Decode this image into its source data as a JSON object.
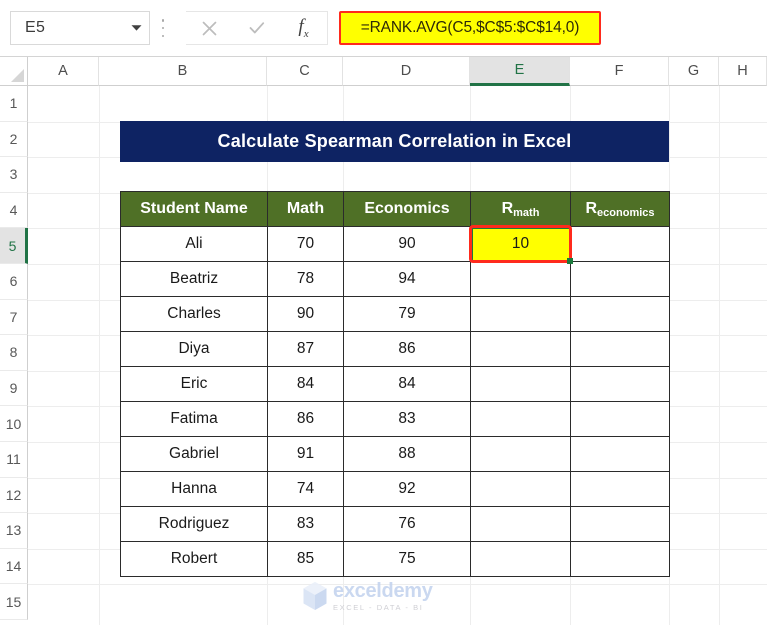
{
  "formula_bar": {
    "name_box_value": "E5",
    "formula": "=RANK.AVG(C5,$C$5:$C$14,0)",
    "cancel_icon": "close-icon",
    "enter_icon": "check-icon",
    "function_icon": "fx-icon",
    "dropdown_icon": "chevron-down-icon",
    "more_icon": "kebab-menu-icon"
  },
  "grid": {
    "columns": [
      "A",
      "B",
      "C",
      "D",
      "E",
      "F",
      "G",
      "H"
    ],
    "selected_column": "E",
    "rows": [
      "1",
      "2",
      "3",
      "4",
      "5",
      "6",
      "7",
      "8",
      "9",
      "10",
      "11",
      "12",
      "13",
      "14",
      "15"
    ],
    "selected_row": "5"
  },
  "banner": {
    "title": "Calculate Spearman Correlation in Excel",
    "background": "#0e2363",
    "text_color": "#ffffff"
  },
  "table": {
    "header_background": "#4f7026",
    "headers": [
      {
        "main": "Student Name",
        "sub": ""
      },
      {
        "main": "Math",
        "sub": ""
      },
      {
        "main": "Economics",
        "sub": ""
      },
      {
        "main": "R",
        "sub": "math"
      },
      {
        "main": "R",
        "sub": "economics"
      }
    ],
    "rows": [
      {
        "name": "Ali",
        "math": "70",
        "economics": "90",
        "r_math": "10",
        "r_economics": ""
      },
      {
        "name": "Beatriz",
        "math": "78",
        "economics": "94",
        "r_math": "",
        "r_economics": ""
      },
      {
        "name": "Charles",
        "math": "90",
        "economics": "79",
        "r_math": "",
        "r_economics": ""
      },
      {
        "name": "Diya",
        "math": "87",
        "economics": "86",
        "r_math": "",
        "r_economics": ""
      },
      {
        "name": "Eric",
        "math": "84",
        "economics": "84",
        "r_math": "",
        "r_economics": ""
      },
      {
        "name": "Fatima",
        "math": "86",
        "economics": "83",
        "r_math": "",
        "r_economics": ""
      },
      {
        "name": "Gabriel",
        "math": "91",
        "economics": "88",
        "r_math": "",
        "r_economics": ""
      },
      {
        "name": "Hanna",
        "math": "74",
        "economics": "92",
        "r_math": "",
        "r_economics": ""
      },
      {
        "name": "Rodriguez",
        "math": "83",
        "economics": "76",
        "r_math": "",
        "r_economics": ""
      },
      {
        "name": "Robert",
        "math": "85",
        "economics": "75",
        "r_math": "",
        "r_economics": ""
      }
    ],
    "selected_cell": {
      "address": "E5",
      "value": "10",
      "fill_color": "#ffff00",
      "annotation_color": "#ff2a1c",
      "selection_color": "#1a7a3c"
    }
  },
  "watermark": {
    "name": "exceldemy",
    "tagline": "EXCEL - DATA - BI"
  }
}
